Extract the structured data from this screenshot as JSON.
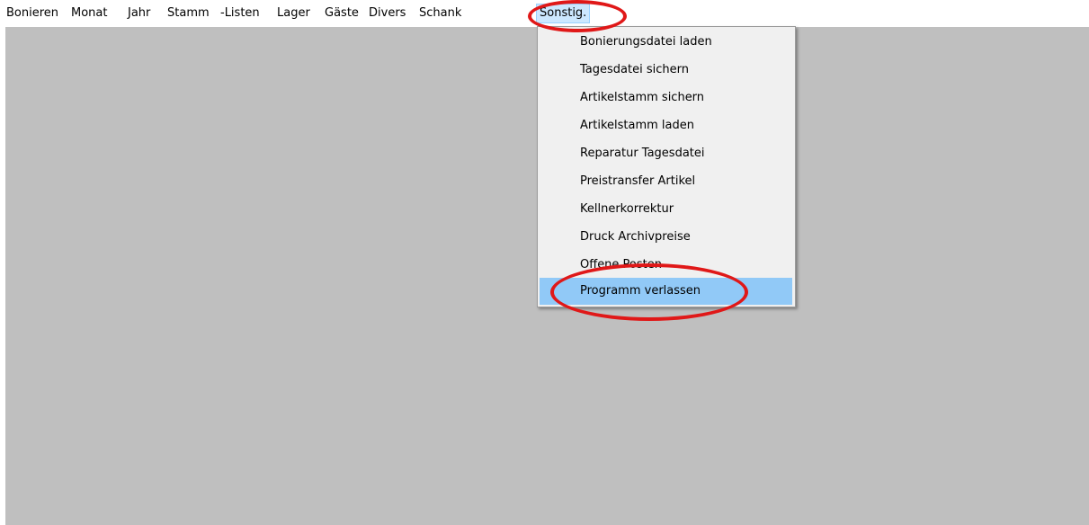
{
  "menubar": {
    "items": [
      {
        "label": "Bonieren"
      },
      {
        "label": "Monat"
      },
      {
        "label": "Jahr"
      },
      {
        "label": "Stamm"
      },
      {
        "label": "-Listen"
      },
      {
        "label": "Lager"
      },
      {
        "label": "Gäste"
      },
      {
        "label": "Divers"
      },
      {
        "label": "Schank"
      },
      {
        "label": "Sonstig.",
        "active": true
      }
    ]
  },
  "dropdown": {
    "items": [
      {
        "label": "Bonierungsdatei laden"
      },
      {
        "label": "Tagesdatei sichern"
      },
      {
        "label": "Artikelstamm sichern"
      },
      {
        "label": "Artikelstamm laden"
      },
      {
        "label": "Reparatur Tagesdatei"
      },
      {
        "label": "Preistransfer Artikel"
      },
      {
        "label": "Kellnerkorrektur"
      },
      {
        "label": "Druck Archivpreise"
      },
      {
        "label": "Offene Posten"
      },
      {
        "label": "Programm verlassen",
        "highlighted": true
      }
    ]
  },
  "colors": {
    "workspace": "#bfbfbf",
    "menu_background": "#f0f0f0",
    "highlight": "#91c9f7",
    "annotation": "#e01818"
  }
}
